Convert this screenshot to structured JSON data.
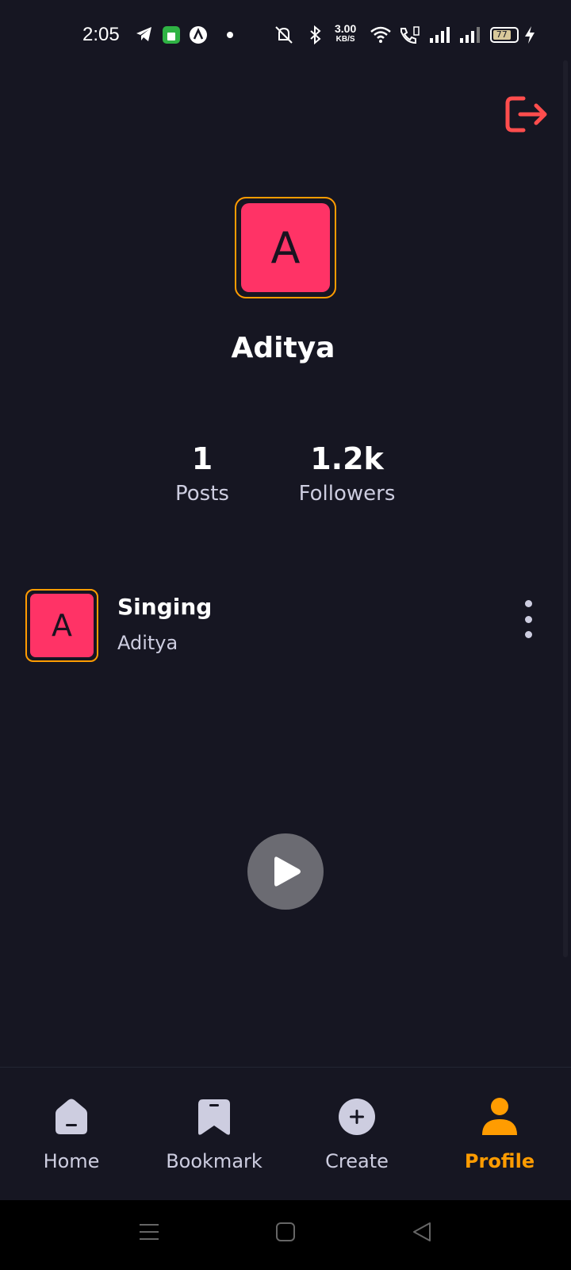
{
  "status_bar": {
    "time": "2:05",
    "net_speed_value": "3.00",
    "net_speed_unit": "KB/S",
    "battery_level": "77"
  },
  "profile": {
    "avatar_initial": "A",
    "name": "Aditya",
    "stats": {
      "posts_value": "1",
      "posts_label": "Posts",
      "followers_value": "1.2k",
      "followers_label": "Followers"
    }
  },
  "posts": [
    {
      "avatar_initial": "A",
      "title": "Singing",
      "author": "Aditya"
    }
  ],
  "tabs": [
    {
      "label": "Home",
      "icon": "home-icon"
    },
    {
      "label": "Bookmark",
      "icon": "bookmark-icon"
    },
    {
      "label": "Create",
      "icon": "plus-icon"
    },
    {
      "label": "Profile",
      "icon": "profile-icon",
      "active": true
    }
  ],
  "colors": {
    "background": "#161622",
    "accent": "#FF9C01",
    "avatar_bg": "#FF3366",
    "logout": "#FF4D4D"
  }
}
